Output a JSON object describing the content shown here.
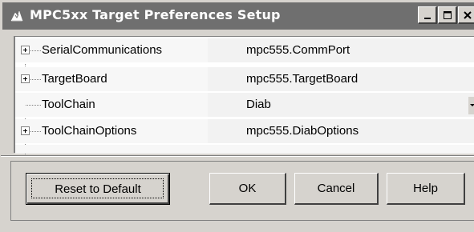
{
  "window": {
    "title": "MPC5xx Target Preferences Setup"
  },
  "icons": {
    "title_icon": "matlab-app-icon",
    "minimize": "minimize-icon",
    "maximize": "maximize-icon",
    "close": "close-icon",
    "expand": "plus-expander-icon",
    "dropdown": "chevron-down-icon"
  },
  "properties": [
    {
      "name": "SerialCommunications",
      "value": "mpc555.CommPort",
      "expandable": true
    },
    {
      "name": "TargetBoard",
      "value": "mpc555.TargetBoard",
      "expandable": true
    },
    {
      "name": "ToolChain",
      "value": "Diab",
      "expandable": false,
      "has_dropdown": true
    },
    {
      "name": "ToolChainOptions",
      "value": "mpc555.DiabOptions",
      "expandable": true
    }
  ],
  "buttons": {
    "reset": "Reset to Default",
    "ok": "OK",
    "cancel": "Cancel",
    "help": "Help"
  },
  "colors": {
    "titlebar": "#6f6f6f",
    "dialog_bg": "#d6d3ce"
  }
}
